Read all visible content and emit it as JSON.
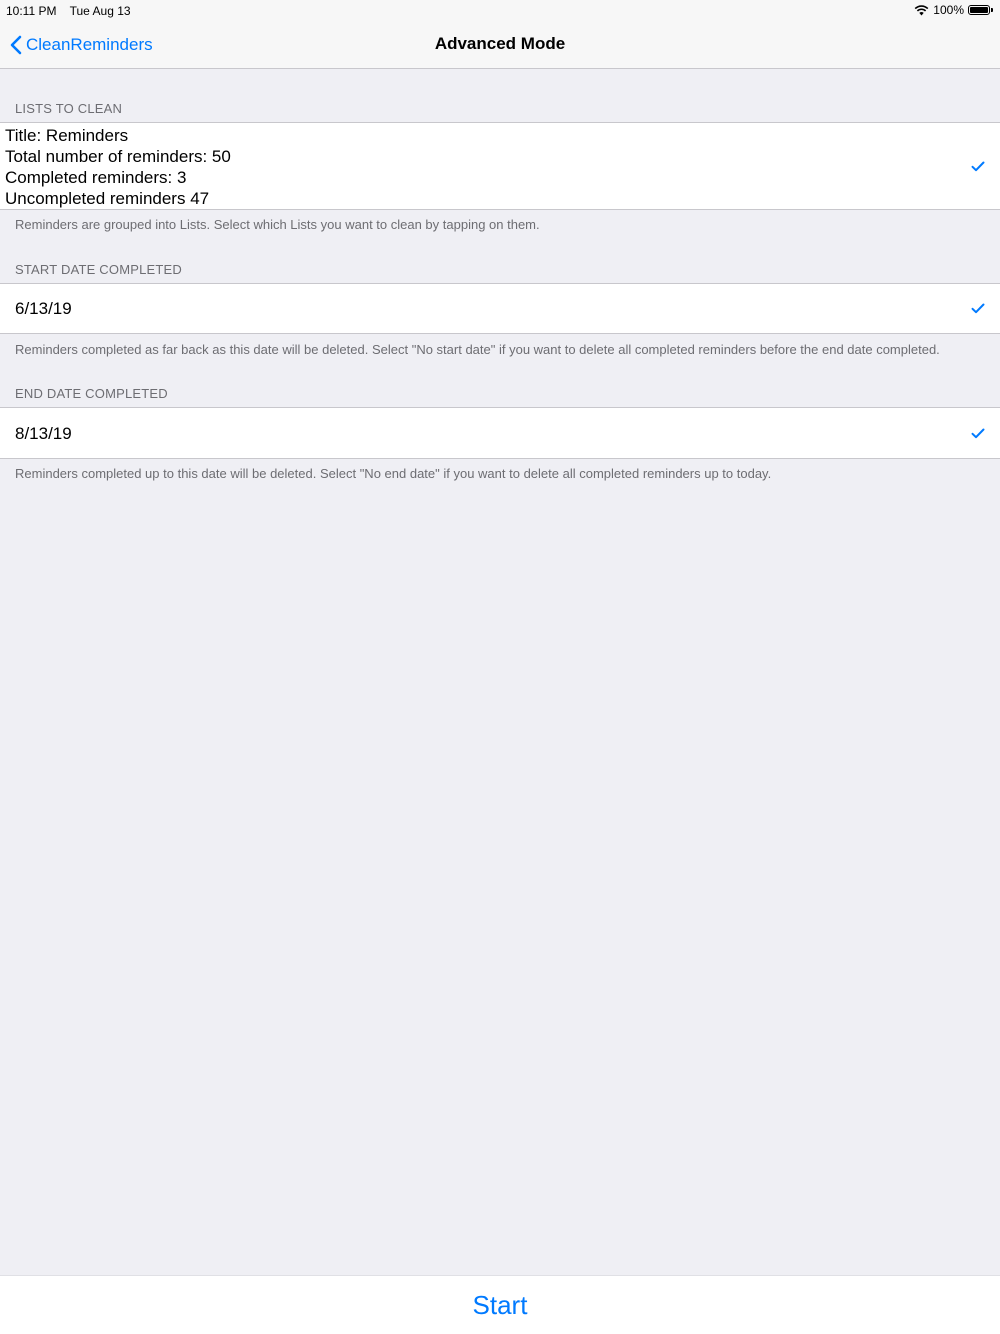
{
  "status_bar": {
    "time": "10:11 PM",
    "date": "Tue Aug 13",
    "battery_percent": "100%",
    "wifi_icon": "wifi-icon",
    "battery_icon": "battery-icon"
  },
  "nav": {
    "back_label": "CleanReminders",
    "title": "Advanced Mode"
  },
  "sections": {
    "lists": {
      "header": "LISTS TO CLEAN",
      "cell_lines": [
        "Title: Reminders",
        "Total number of reminders: 50",
        "Completed reminders: 3",
        "Uncompleted reminders 47"
      ],
      "selected": true,
      "footer": "Reminders are grouped into Lists. Select which Lists you want to clean by tapping on them."
    },
    "start_date": {
      "header": "START DATE COMPLETED",
      "value": "6/13/19",
      "selected": true,
      "footer": "Reminders completed as far back as this date will be deleted. Select \"No start date\" if you want to delete all completed reminders before the end date completed."
    },
    "end_date": {
      "header": "END DATE COMPLETED",
      "value": "8/13/19",
      "selected": true,
      "footer": "Reminders completed up to this date will be deleted. Select \"No end date\" if you want to delete all completed reminders up to today."
    }
  },
  "toolbar": {
    "start_label": "Start"
  },
  "colors": {
    "accent": "#007aff",
    "background": "#efeff4",
    "secondary_text": "#6d6d72",
    "separator": "#c8c7cc"
  }
}
